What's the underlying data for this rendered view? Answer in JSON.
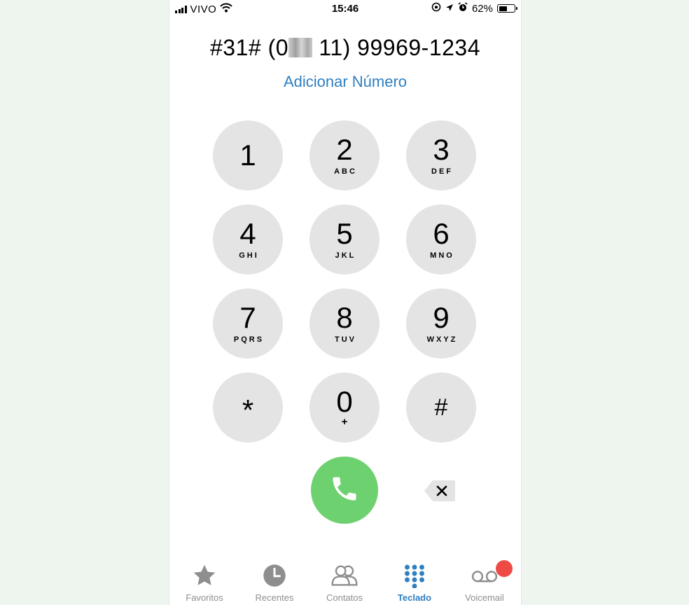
{
  "status_bar": {
    "carrier": "VIVO",
    "time": "15:46",
    "battery": "62%",
    "battery_level": 0.62,
    "icons": [
      "signal-bars-icon",
      "wifi-icon",
      "rotation-lock-icon",
      "location-icon",
      "alarm-icon",
      "battery-icon"
    ]
  },
  "dialer": {
    "number_prefix": "#31# (0",
    "number_suffix": " 11) 99969-1234",
    "add_number_label": "Adicionar Número",
    "keys": [
      {
        "digit": "1",
        "letters": ""
      },
      {
        "digit": "2",
        "letters": "ABC"
      },
      {
        "digit": "3",
        "letters": "DEF"
      },
      {
        "digit": "4",
        "letters": "GHI"
      },
      {
        "digit": "5",
        "letters": "JKL"
      },
      {
        "digit": "6",
        "letters": "MNO"
      },
      {
        "digit": "7",
        "letters": "PQRS"
      },
      {
        "digit": "8",
        "letters": "TUV"
      },
      {
        "digit": "9",
        "letters": "WXYZ"
      },
      {
        "digit": "*",
        "letters": ""
      },
      {
        "digit": "0",
        "letters": "+"
      },
      {
        "digit": "#",
        "letters": ""
      }
    ],
    "call_button_color": "#6dd16f",
    "key_color": "#e4e4e4"
  },
  "tab_bar": {
    "active_color": "#2f7fc1",
    "badge_color": "#ef4b46",
    "tabs": [
      {
        "label": "Favoritos",
        "icon": "star-icon"
      },
      {
        "label": "Recentes",
        "icon": "clock-icon"
      },
      {
        "label": "Contatos",
        "icon": "contacts-icon"
      },
      {
        "label": "Teclado",
        "icon": "keypad-icon",
        "active": true
      },
      {
        "label": "Voicemail",
        "icon": "voicemail-icon"
      }
    ]
  }
}
